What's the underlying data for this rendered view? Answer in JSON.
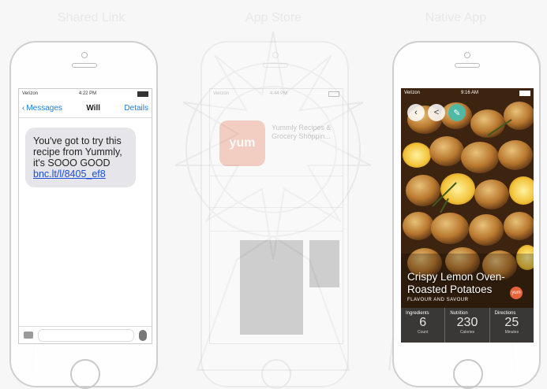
{
  "labels": {
    "left": "Shared Link",
    "middle": "App Store",
    "right": "Native App"
  },
  "messages": {
    "carrier": "Verizon",
    "time": "4:22 PM",
    "back": "Messages",
    "title": "Will",
    "details": "Details",
    "text": "You've got to try this recipe from Yummly, it's SOOO GOOD",
    "link": "bnc.lt/l/8405_ef8"
  },
  "store": {
    "carrier": "Verizon",
    "time": "4:44 PM",
    "app_icon_text": "yum",
    "app_name": "Yummly Recipes & Grocery Shoppin..."
  },
  "app": {
    "carrier": "Verizon",
    "time": "9:16 AM",
    "recipe_title": "Crispy Lemon Oven-Roasted Potatoes",
    "recipe_source": "FLAVOUR AND SAVOUR",
    "badge": "yum",
    "stats": [
      {
        "label": "Ingredients",
        "value": "6",
        "unit": "Count"
      },
      {
        "label": "Nutrition",
        "value": "230",
        "unit": "Calories"
      },
      {
        "label": "Directions",
        "value": "25",
        "unit": "Minutes"
      }
    ]
  },
  "colors": {
    "link": "#1a4fd8",
    "ios_blue": "#1a7cd8",
    "brand_orange": "#e8643c",
    "teal": "#4fb9a6"
  }
}
